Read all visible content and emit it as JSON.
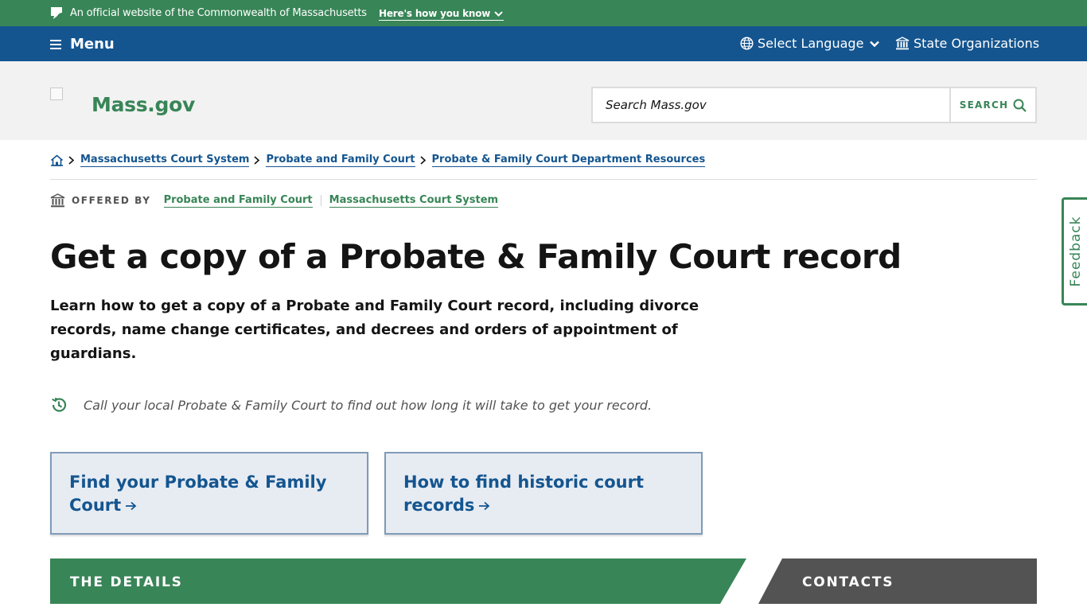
{
  "official_bar": {
    "text": "An official website of the Commonwealth of Massachusetts",
    "how_link": "Here's how you know"
  },
  "nav": {
    "menu_label": "Menu",
    "language_label": "Select Language",
    "orgs_label": "State Organizations"
  },
  "header": {
    "logo_text": "Mass.gov",
    "search_placeholder": "Search Mass.gov",
    "search_button": "SEARCH"
  },
  "breadcrumb": {
    "items": [
      {
        "label": "Massachusetts Court System"
      },
      {
        "label": "Probate and Family Court"
      },
      {
        "label": "Probate & Family Court Department Resources"
      }
    ]
  },
  "offered_by": {
    "label": "OFFERED BY",
    "orgs": [
      {
        "label": "Probate and Family Court"
      },
      {
        "label": "Massachusetts Court System"
      }
    ]
  },
  "page": {
    "title": "Get a copy of a Probate & Family Court record",
    "lede": "Learn how to get a copy of a Probate and Family Court record, including divorce records, name change certificates, and decrees and orders of appointment of guardians.",
    "notice": "Call your local Probate & Family Court to find out how long it will take to get your record."
  },
  "cards": [
    {
      "title": "Find your Probate & Family Court"
    },
    {
      "title": "How to find historic court records"
    }
  ],
  "tabs": {
    "details": "THE DETAILS",
    "contacts": "CONTACTS"
  },
  "feedback_label": "Feedback",
  "colors": {
    "green": "#388557",
    "blue": "#14558f",
    "dark_gray": "#535353",
    "card_bg": "#e7ecf3",
    "header_bg": "#f2f2f2"
  }
}
